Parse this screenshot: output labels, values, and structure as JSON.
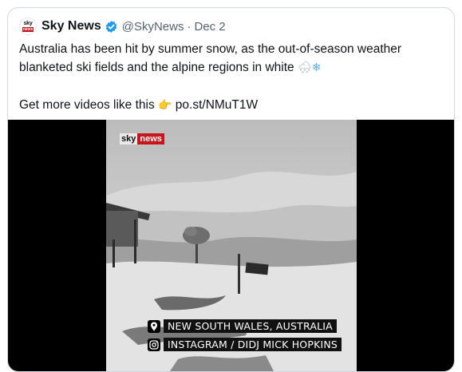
{
  "tweet": {
    "author": {
      "name": "Sky News",
      "handle": "@SkyNews",
      "avatar_text_top": "sky",
      "avatar_text_bottom": "news",
      "verified_icon": "verified-badge-icon"
    },
    "separator": "·",
    "date": "Dec 2",
    "text_line1": "Australia has been hit by summer snow, as the out-of-season weather blanketed ski fields and the alpine regions in white",
    "emoji_snow_cloud": "🌨",
    "emoji_snowflake": "❄",
    "text_line2": "Get more videos like this",
    "emoji_pointing": "👉",
    "link": "po.st/NMuT1W"
  },
  "video": {
    "logo_sky": "sky",
    "logo_news": "news",
    "caption_location": "NEW SOUTH WALES, AUSTRALIA",
    "caption_source": "INSTAGRAM / DIDJ MICK HOPKINS",
    "location_icon": "location-pin-icon",
    "instagram_icon": "instagram-icon"
  },
  "colors": {
    "text": "#0f1419",
    "secondary": "#536471",
    "verified": "#1d9bf0",
    "sky_red": "#c4161c"
  }
}
